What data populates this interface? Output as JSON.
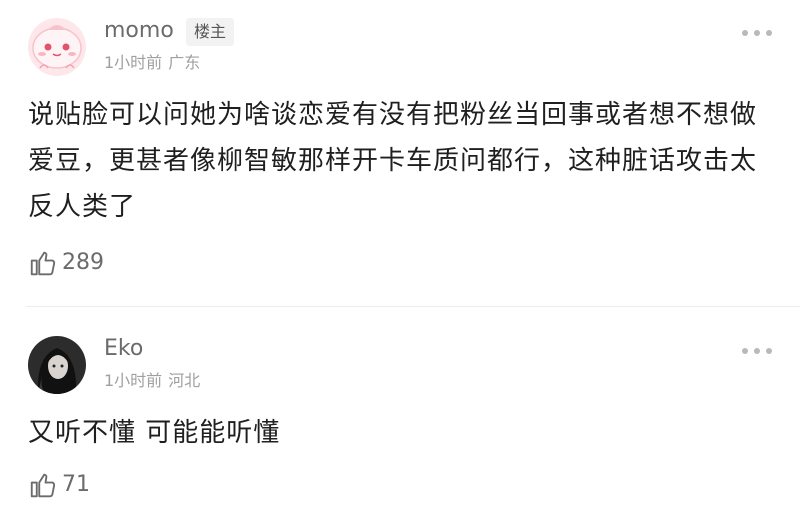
{
  "comments": [
    {
      "username": "momo",
      "badge": "楼主",
      "time": "1小时前",
      "location": "广东",
      "text": "说贴脸可以问她为啥谈恋爱有没有把粉丝当回事或者想不想做爱豆，更甚者像柳智敏那样开卡车质问都行，这种脏话攻击太反人类了",
      "likes": "289",
      "avatar_icon": "pink-cartoon-avatar"
    },
    {
      "username": "Eko",
      "time": "1小时前",
      "location": "河北",
      "text": "又听不懂 可能能听懂",
      "likes": "71",
      "avatar_icon": "dark-portrait-avatar"
    }
  ],
  "icons": {
    "like": "thumbs-up-icon",
    "more": "more-dots-icon"
  },
  "colors": {
    "username": "#6b6b6b",
    "meta": "#a0a0a0",
    "body": "#1f1f1f",
    "badge_bg": "#f2f2f2"
  }
}
